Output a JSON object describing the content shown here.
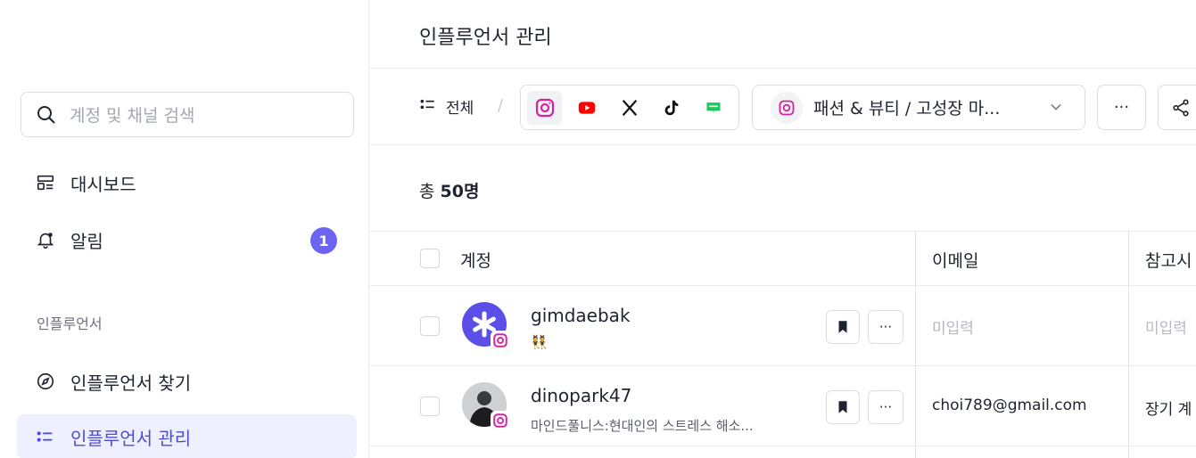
{
  "sidebar": {
    "search_placeholder": "계정 및 채널 검색",
    "items": [
      {
        "label": "대시보드",
        "icon": "dashboard-icon"
      },
      {
        "label": "알림",
        "icon": "bell-icon",
        "badge": "1"
      }
    ],
    "section_label": "인플루언서",
    "influencer_items": [
      {
        "label": "인플루언서 찾기",
        "icon": "compass-icon"
      },
      {
        "label": "인플루언서 관리",
        "icon": "list-icon",
        "active": true
      }
    ]
  },
  "header": {
    "title": "인플루언서 관리"
  },
  "toolbar": {
    "all_label": "전체",
    "platforms": [
      "instagram",
      "youtube",
      "x",
      "tiktok",
      "naver-blog"
    ],
    "selected_platform": "instagram",
    "campaign": "패션 & 뷰티 / 고성장 마...",
    "more_label": "···"
  },
  "summary": {
    "prefix": "총 ",
    "count": "50명"
  },
  "table": {
    "headers": [
      "계정",
      "이메일",
      "참고시"
    ],
    "rows": [
      {
        "name": "gimdaebak",
        "sub": "👯",
        "email": "미입력",
        "note": "미입력",
        "email_missing": true
      },
      {
        "name": "dinopark47",
        "sub": "마인드풀니스:현대인의 스트레스 해소...",
        "email": "choi789@gmail.com",
        "note": "장기 계",
        "email_missing": false
      }
    ],
    "more_label": "···"
  },
  "colors": {
    "accent": "#6b63f2",
    "active_bg": "#eef0ff",
    "instagram": "#d6249f",
    "youtube": "#ff0000"
  }
}
